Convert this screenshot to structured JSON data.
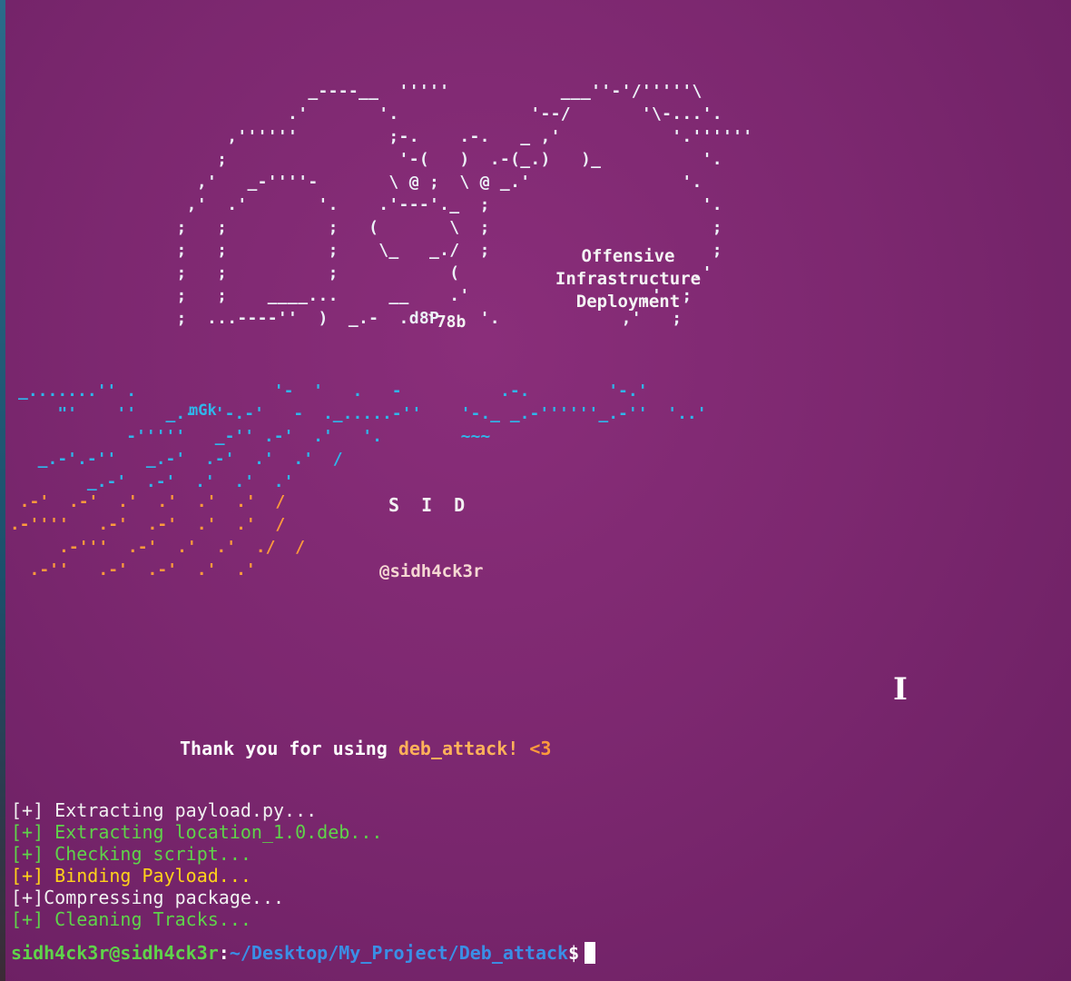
{
  "ascii_art": {
    "cloud": "                 _----__  '''''           ___''-'/'''''\\\n               .'       '.             '--/       '\\-...'.\n         ,''''''         ;-.    .-.   _ ,'           '.''''''\n        ;                 '-(   )  .-(_.)   )_          '.\n      ,'   _-''''-       \\ @ ;  \\ @ _.'               '.\n     ,'  .'       '.    .'---'._  ;                     '.\n    ;   ;          ;   (       \\  ;                      ;\n    ;   ;          ;    \\_   _./  ;                      ;\n    ;   ;          ;           (                       .'\n    ;   ;    ____...     __    .'                 ,'  ;\n    ;  ...----''  )  _.-  .d8P    '.            ,'   ;",
    "blue_trails": "_.......'' .              '-  '   .   -          .-.        '-.'\n    \"'    ''   _.-'''-.-'   -  ._.....-''    '-._ _.-''''''_.-''  '..'\n           -'''''   _-'' .-'  .'   '.        ~~~\n  _.-'.-''   _.-'  .-'  .'  .'  /\n       _.-'  .-'  .'  .'  .'",
    "orange_trails": "  .-'  .-'  .'  .'  .'  .'  /\n .-''''   .-'  .-'  .'  .'  /\n      .-'''  .-'  .'  .'  ./  /\n   .-''   .-'  .-'  .'  .'"
  },
  "banner": {
    "title_lines": [
      "Offensive",
      "Infrastructure",
      "Deployment"
    ],
    "code_top": "`78b",
    "author_letters": "S I D",
    "handle": "@sidh4ck3r",
    "tag": "mGk"
  },
  "thanks": {
    "prefix": "Thank you for using ",
    "app": "deb_attack!",
    "heart": " <3"
  },
  "log": [
    {
      "text": "[+] Extracting payload.py...",
      "color": "white"
    },
    {
      "text": "[+] Extracting location_1.0.deb...",
      "color": "green"
    },
    {
      "text": "[+] Checking script...",
      "color": "green"
    },
    {
      "text": "[+] Binding Payload...",
      "color": "yellow"
    },
    {
      "text": "[+]Compressing package...",
      "color": "white"
    },
    {
      "text": "[+] Cleaning Tracks...",
      "color": "green"
    }
  ],
  "prompt": {
    "user_host": "sidh4ck3r@sidh4ck3r",
    "colon": ":",
    "path": "~/Desktop/My_Project/Deb_attack",
    "dollar": "$"
  },
  "colors": {
    "background": "#7d2870",
    "green": "#5fd34a",
    "yellow": "#ffd21a",
    "blue_path": "#3a8fe6",
    "ascii_blue": "#2fb6ea",
    "ascii_orange": "#ff9a3c"
  },
  "icons": {
    "mouse_cursor": "i-beam-cursor-icon",
    "text_cursor": "block-cursor-icon"
  }
}
